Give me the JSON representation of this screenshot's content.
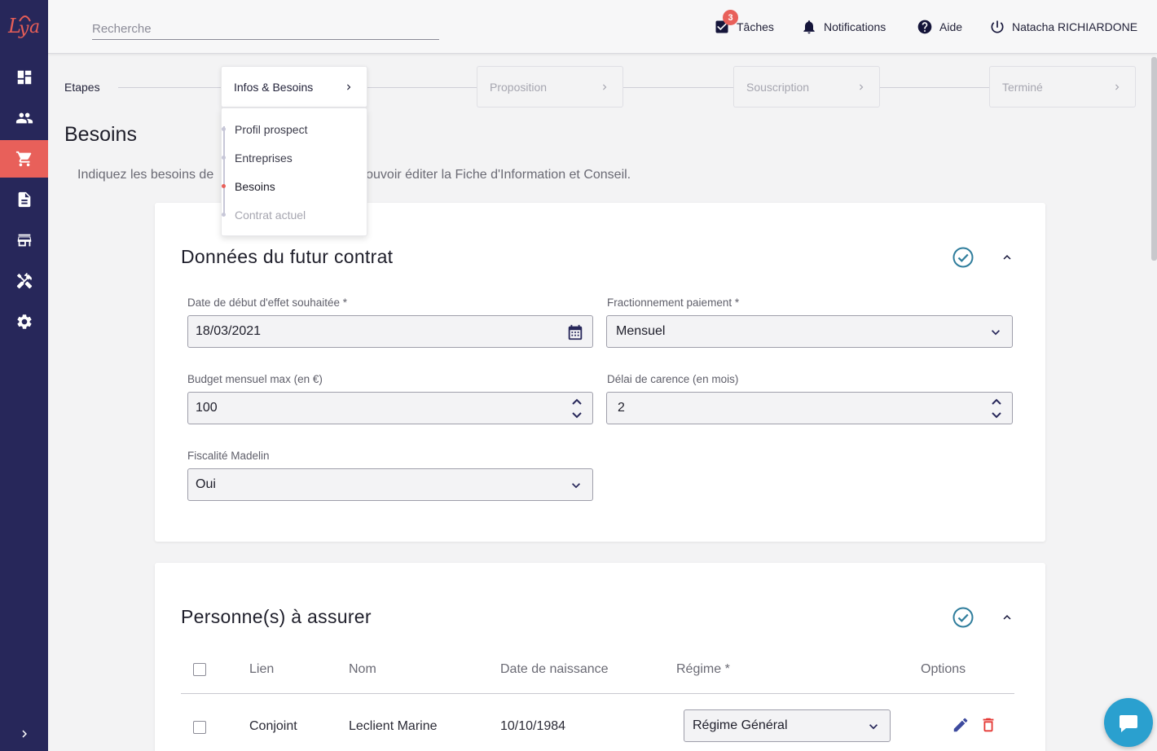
{
  "app": {
    "logo_text": "Lya"
  },
  "sidebar": {
    "items": [
      {
        "icon": "dashboard-icon"
      },
      {
        "icon": "people-icon"
      },
      {
        "icon": "cart-icon",
        "active": true
      },
      {
        "icon": "document-icon"
      },
      {
        "icon": "store-icon"
      },
      {
        "icon": "tools-icon"
      },
      {
        "icon": "gear-icon"
      }
    ],
    "expand_icon": "chevron-right-icon"
  },
  "topbar": {
    "search_placeholder": "Recherche",
    "tasks_label": "Tâches",
    "tasks_count": "3",
    "notifications_label": "Notifications",
    "help_label": "Aide",
    "user_name": "Natacha RICHIARDONE"
  },
  "stepper": {
    "label": "Etapes",
    "steps": [
      {
        "label": "Infos & Besoins",
        "state": "current"
      },
      {
        "label": "Proposition",
        "state": "upcoming"
      },
      {
        "label": "Souscription",
        "state": "upcoming"
      },
      {
        "label": "Terminé",
        "state": "upcoming"
      }
    ],
    "substeps": [
      {
        "label": "Profil prospect",
        "state": "done"
      },
      {
        "label": "Entreprises",
        "state": "done"
      },
      {
        "label": "Besoins",
        "state": "active"
      },
      {
        "label": "Contrat actuel",
        "state": "disabled"
      }
    ]
  },
  "page": {
    "title": "Besoins",
    "intro_left": "Indiquez les besoins de",
    "intro_right": "pouvoir éditer la Fiche d'Information et Conseil."
  },
  "contract_card": {
    "title": "Données du futur contrat",
    "fields": {
      "start_date": {
        "label": "Date de début d'effet souhaitée *",
        "value": "18/03/2021"
      },
      "payment_split": {
        "label": "Fractionnement paiement *",
        "value": "Mensuel"
      },
      "budget": {
        "label": "Budget mensuel max (en €)",
        "value": "100"
      },
      "waiting_period": {
        "label": "Délai de carence (en mois)",
        "value": "2"
      },
      "madelin": {
        "label": "Fiscalité Madelin",
        "value": "Oui"
      }
    }
  },
  "insured_card": {
    "title": "Personne(s) à assurer",
    "columns": {
      "link": "Lien",
      "name": "Nom",
      "birthdate": "Date de naissance",
      "regime": "Régime *",
      "options": "Options"
    },
    "rows": [
      {
        "link": "Conjoint",
        "name": "Leclient Marine",
        "birthdate": "10/10/1984",
        "regime": "Régime Général"
      }
    ]
  },
  "colors": {
    "sidebar": "#27275a",
    "accent": "#e8605a",
    "check": "#2f7d9c",
    "chat": "#2aa0cf"
  }
}
